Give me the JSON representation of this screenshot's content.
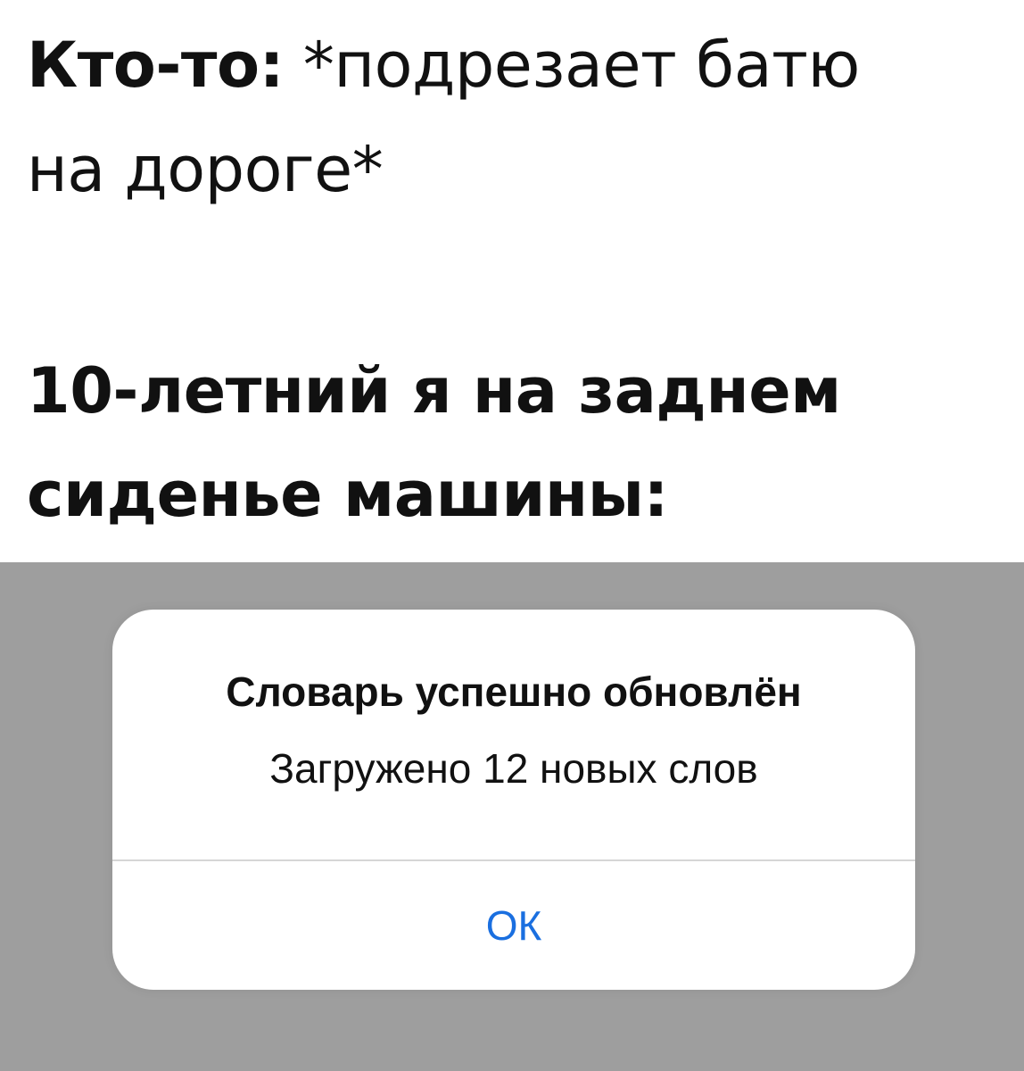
{
  "caption": {
    "line1_bold": "Кто-то:",
    "line1_normal": " *подрезает батю",
    "line2": "на дороге*",
    "line3": "10-летний я на заднем",
    "line4": "сиденье машины:"
  },
  "alert": {
    "title": "Словарь успешно обновлён",
    "message": "Загружено 12 новых слов",
    "ok_label": "ОК"
  },
  "colors": {
    "screen_background": "#9e9e9e",
    "alert_background": "#ffffff",
    "ok_button_text": "#1a6fe0",
    "divider": "#d6d6d6"
  }
}
